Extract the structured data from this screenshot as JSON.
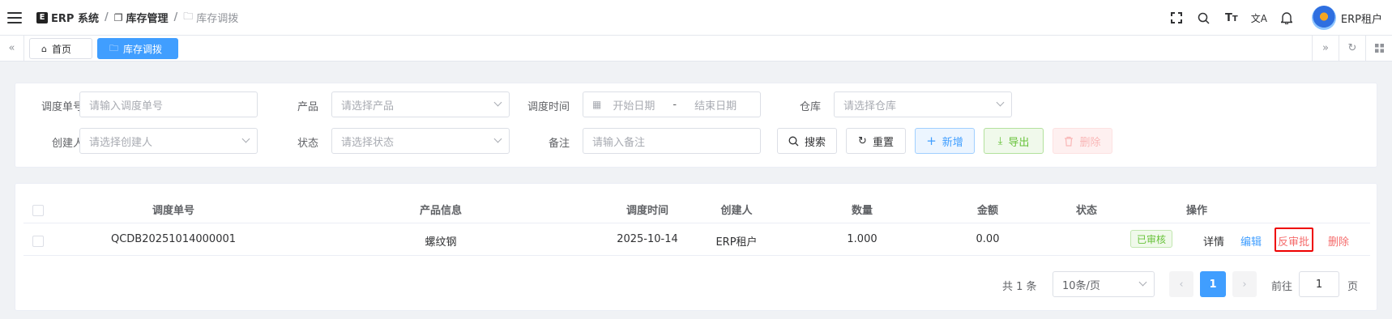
{
  "header": {
    "breadcrumb": {
      "app": "ERP 系统",
      "section": "库存管理",
      "page": "库存调拨"
    },
    "user_name": "ERP租户"
  },
  "tags": {
    "home": "首页",
    "active": "库存调拨"
  },
  "search": {
    "fields": {
      "order_no": {
        "label": "调度单号",
        "placeholder": "请输入调度单号"
      },
      "product": {
        "label": "产品",
        "placeholder": "请选择产品"
      },
      "time": {
        "label": "调度时间",
        "start": "开始日期",
        "sep": "-",
        "end": "结束日期"
      },
      "warehouse": {
        "label": "仓库",
        "placeholder": "请选择仓库"
      },
      "creator": {
        "label": "创建人",
        "placeholder": "请选择创建人"
      },
      "status": {
        "label": "状态",
        "placeholder": "请选择状态"
      },
      "remark": {
        "label": "备注",
        "placeholder": "请输入备注"
      }
    },
    "buttons": {
      "search": "搜索",
      "reset": "重置",
      "add": "新增",
      "export": "导出",
      "delete": "删除"
    }
  },
  "table": {
    "columns": [
      "调度单号",
      "产品信息",
      "调度时间",
      "创建人",
      "数量",
      "金额",
      "状态",
      "操作"
    ],
    "rows": [
      {
        "order_no": "QCDB20251014000001",
        "product": "螺纹钢",
        "time": "2025-10-14",
        "creator": "ERP租户",
        "quantity": "1.000",
        "amount": "0.00",
        "status": "已审核",
        "actions": {
          "detail": "详情",
          "edit": "编辑",
          "unapprove": "反审批",
          "delete": "删除"
        }
      }
    ]
  },
  "pagination": {
    "total": "共 1 条",
    "page_size": "10条/页",
    "current_page": "1",
    "goto_prefix": "前往",
    "goto_value": "1",
    "goto_suffix": "页"
  },
  "colors": {
    "primary": "#409eff",
    "success": "#67c23a",
    "danger": "#f56c6c",
    "highlight": "#ee0000"
  }
}
